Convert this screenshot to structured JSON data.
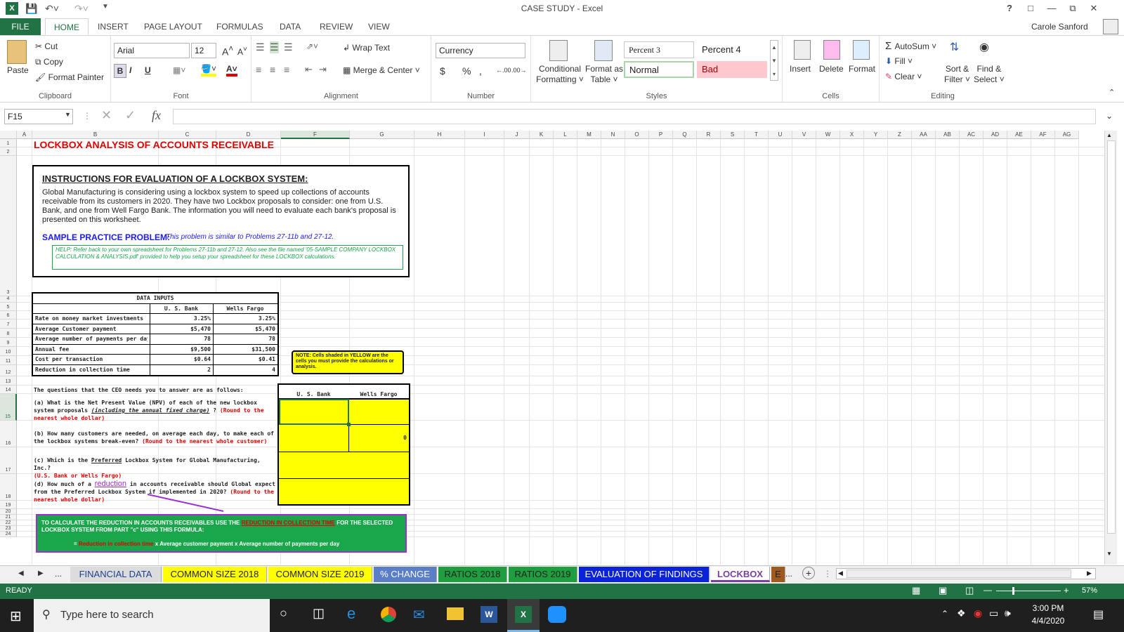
{
  "window": {
    "title": "CASE STUDY - Excel",
    "user": "Carole Sanford",
    "help": "?"
  },
  "ribbon_tabs": [
    "FILE",
    "HOME",
    "INSERT",
    "PAGE LAYOUT",
    "FORMULAS",
    "DATA",
    "REVIEW",
    "VIEW"
  ],
  "clipboard": {
    "paste": "Paste",
    "cut": "Cut",
    "copy": "Copy",
    "format_painter": "Format Painter",
    "label": "Clipboard"
  },
  "font": {
    "name": "Arial",
    "size": "12",
    "bold": "B",
    "italic": "I",
    "underline": "U",
    "label": "Font"
  },
  "alignment": {
    "wrap": "Wrap Text",
    "merge": "Merge & Center",
    "label": "Alignment"
  },
  "number": {
    "format": "Currency",
    "dollar": "$",
    "percent": "%",
    "comma": ",",
    "label": "Number"
  },
  "styles": {
    "conditional": "Conditional",
    "formatting": "Formatting",
    "format_as": "Format as",
    "table": "Table",
    "percent3": "Percent 3",
    "percent4": "Percent 4",
    "normal": "Normal",
    "bad": "Bad",
    "label": "Styles"
  },
  "cells": {
    "insert": "Insert",
    "delete": "Delete",
    "format": "Format",
    "label": "Cells"
  },
  "editing": {
    "autosum": "AutoSum",
    "fill": "Fill",
    "clear": "Clear",
    "sort": "Sort &",
    "filter": "Filter",
    "find": "Find &",
    "select": "Select",
    "label": "Editing"
  },
  "formula_bar": {
    "name_box": "F15",
    "fx": "fx",
    "value": ""
  },
  "columns": [
    "A",
    "B",
    "C",
    "D",
    "F",
    "G",
    "H",
    "I",
    "J",
    "K",
    "L",
    "M",
    "N",
    "O",
    "P",
    "Q",
    "R",
    "S",
    "T",
    "U",
    "V",
    "W",
    "X",
    "Y",
    "Z",
    "AA",
    "AB",
    "AC",
    "AD",
    "AE",
    "AF",
    "AG"
  ],
  "rows": [
    "1",
    "2",
    "3",
    "4",
    "5",
    "6",
    "7",
    "8",
    "9",
    "10",
    "11",
    "12",
    "13",
    "14",
    "15",
    "16",
    "17",
    "18",
    "19",
    "20",
    "21",
    "22",
    "23",
    "24"
  ],
  "sheet": {
    "title": "LOCKBOX ANALYSIS OF ACCOUNTS RECEIVABLE",
    "instructions_heading": "INSTRUCTIONS FOR EVALUATION OF A LOCKBOX SYSTEM:",
    "instructions_body": "Global Manufacturing is considering using a lockbox system to speed up collections of accounts receivable from its customers in 2020.  They have two Lockbox proposals to consider: one from U.S. Bank, and one from Well Fargo Bank. The information you will need to evaluate each bank's proposal is presented on this worksheet.",
    "sample_label": "SAMPLE PRACTICE PROBLEM:",
    "sample_text": "This problem is similar to Problems 27-11b and 27-12.",
    "help_text": "HELP:  Refer back to your own spreadsheet for Problems 27-11b and 27-12.  Also see the file named '05-SAMPLE COMPANY LOCKBOX CALCULATION & ANALYSIS.pdf' provided to help you setup your spreadsheet for these LOCKBOX calculations.",
    "data_inputs": {
      "header": "DATA INPUTS",
      "col1": "U. S. Bank",
      "col2": "Wells Fargo",
      "rows": [
        {
          "label": "Rate on money market investments",
          "us": "3.25%",
          "wf": "3.25%"
        },
        {
          "label": "Average Customer payment",
          "us": "$5,470",
          "wf": "$5,470"
        },
        {
          "label": "Average number of payments per day",
          "us": "78",
          "wf": "78"
        },
        {
          "label": "Annual fee",
          "us": "$9,500",
          "wf": "$31,500"
        },
        {
          "label": "Cost per transaction",
          "us": "$0.64",
          "wf": "$0.41"
        },
        {
          "label": "Reduction in collection time",
          "us": "2",
          "wf": "4"
        }
      ]
    },
    "note": "NOTE:  Cells shaded in YELLOW are the cells you must provide the calculations or analysis.",
    "questions_intro": "The questions that the CEO needs you to answer are as follows:",
    "answer_col1": "U. S. Bank",
    "answer_col2": "Wells Fargo",
    "q_a": "(a) What is the Net Present Value (NPV) of each of the new lockbox system proposals",
    "q_a_u": "(including the annual fixed charge)",
    "q_a_end": "?",
    "q_a_red": "(Round to the nearest whole dollar)",
    "q_b": "(b) How many customers are needed, on average each day, to make each of the  lockbox systems break-even?",
    "q_b_red": "(Round to the nearest whole customer)",
    "q_c": "(c) Which is the",
    "q_c_u": "Preferred",
    "q_c_end": "Lockbox System for Global Manufacturing, Inc.?",
    "q_c_red": "(U.S. Bank or Wells Fargo)",
    "q_d": "(d) How much of a",
    "q_d_link": "reduction",
    "q_d_end": "in accounts receivable should Global expect from the Preferred Lockbox System if implemented in 2020?",
    "q_d_red": "(Round to the nearest whole dollar)",
    "answer_b_wf": "0",
    "formula_box_1": "TO CALCULATE THE REDUCTION IN ACCOUNTS RECEIVABLES USE THE",
    "formula_box_red": "REDUCTION IN COLLECTION TIME",
    "formula_box_2": "FOR THE SELECTED LOCKBOX SYSTEM FROM PART \"c\" USING THIS FORMULA:",
    "formula_eq": "=",
    "formula_red2": "Reduction in collection time",
    "formula_rest": "x Average customer payment x Average number of payments per day"
  },
  "sheet_tabs": [
    {
      "label": "FINANCIAL DATA",
      "bg": "#dcdcdc",
      "fg": "#1f3f8f"
    },
    {
      "label": "COMMON SIZE 2018",
      "bg": "#ffff00",
      "fg": "#222"
    },
    {
      "label": "COMMON SIZE 2019",
      "bg": "#ffff00",
      "fg": "#222"
    },
    {
      "label": "% CHANGE",
      "bg": "#5b7fc7",
      "fg": "#fff"
    },
    {
      "label": "RATIOS 2018",
      "bg": "#1e9e3e",
      "fg": "#222"
    },
    {
      "label": "RATIOS 2019",
      "bg": "#1e9e3e",
      "fg": "#222"
    },
    {
      "label": "EVALUATION OF FINDINGS",
      "bg": "#0a23d8",
      "fg": "#fff"
    },
    {
      "label": "LOCKBOX",
      "bg": "#fff",
      "fg": "#7b3fa0"
    },
    {
      "label": "E",
      "bg": "#a05a1e",
      "fg": "#222"
    }
  ],
  "sheet_nav": {
    "ellipsis": "...",
    "add": "+"
  },
  "status": {
    "mode": "READY",
    "zoom": "57%"
  },
  "taskbar": {
    "search_placeholder": "Type here to search",
    "time": "3:00 PM",
    "date": "4/4/2020"
  },
  "colors": {
    "excel_green": "#217346",
    "yellow": "#ffff00",
    "red": "#e00000",
    "blue": "#1a1aff",
    "help_green": "#1aa64a"
  }
}
